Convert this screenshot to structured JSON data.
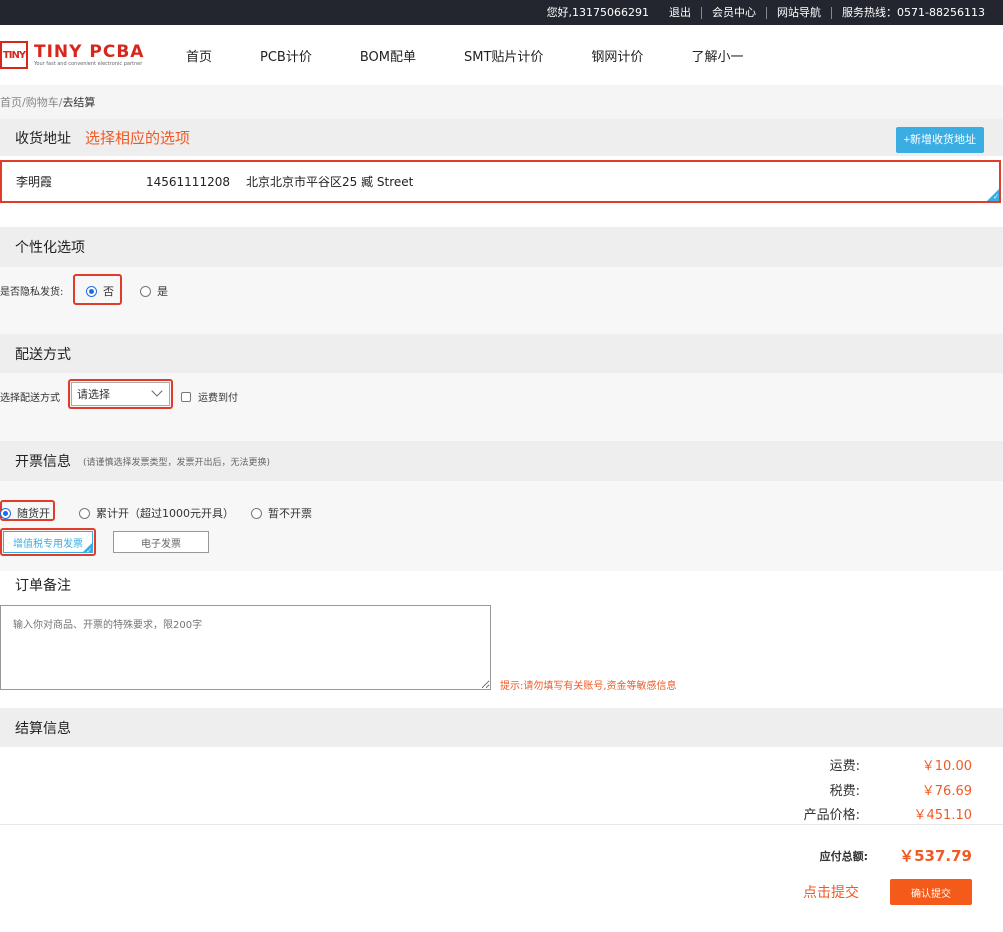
{
  "topbar": {
    "greeting": "您好,13175066291",
    "logout": "退出",
    "member": "会员中心",
    "sitemap": "网站导航",
    "hotline": "服务热线：0571-88256113"
  },
  "logo": {
    "mark": "TINY",
    "name": "TINY PCBA",
    "tagline": "Your fast and convenient electronic partner"
  },
  "nav": [
    "首页",
    "PCB计价",
    "BOM配单",
    "SMT贴片计价",
    "钢网计价",
    "了解小一"
  ],
  "breadcrumb": {
    "home": "首页",
    "cart": "购物车",
    "current": "去结算"
  },
  "address": {
    "title": "收货地址",
    "hint": "选择相应的选项",
    "add_button": "+新增收货地址",
    "name": "李明霞",
    "phone": "14561111208",
    "detail": "北京北京市平谷区25 臧 Street"
  },
  "personal": {
    "title": "个性化选项",
    "label": "是否隐私发货:",
    "no": "否",
    "yes": "是",
    "selected": "否"
  },
  "delivery": {
    "title": "配送方式",
    "label": "选择配送方式",
    "select_value": "请选择",
    "freight_collect": "运费到付"
  },
  "invoice": {
    "title": "开票信息",
    "note": "(请谨慎选择发票类型，发票开出后，无法更换)",
    "opt1": "随货开",
    "opt2": "累计开（超过1000元开具）",
    "opt3": "暂不开票",
    "selected": "随货开",
    "type_vat": "增值税专用发票",
    "type_electronic": "电子发票"
  },
  "remark": {
    "title": "订单备注",
    "placeholder": "输入你对商品、开票的特殊要求，限200字",
    "warning": "提示:请勿填写有关账号,资金等敏感信息"
  },
  "settlement": {
    "title": "结算信息",
    "shipping_label": "运费:",
    "shipping_value": "￥10.00",
    "tax_label": "税费:",
    "tax_value": "￥76.69",
    "product_label": "产品价格:",
    "product_value": "￥451.10",
    "total_label": "应付总额:",
    "total_value": "￥537.79",
    "click_hint": "点击提交",
    "submit": "确认提交"
  },
  "colors": {
    "accent": "#f05a24",
    "highlight_border": "#e03c2c",
    "blue": "#3aaee3",
    "topbar": "#23262e"
  }
}
